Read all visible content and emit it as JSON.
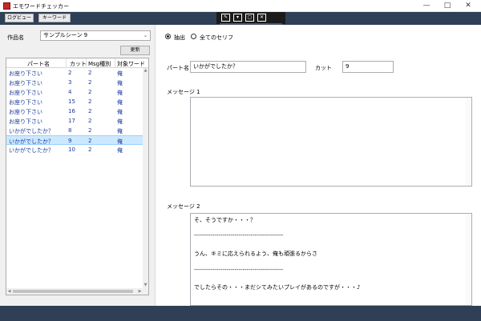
{
  "window": {
    "title": "エモワードチェッカー",
    "min_glyph": "—",
    "max_glyph": "□",
    "close_glyph": "✕"
  },
  "toolbar": {
    "copy_label": "ログビュー",
    "keyword_label": "キーワード"
  },
  "floating_toolbar": {
    "icons": [
      "edit-icon",
      "comment-icon",
      "frame-icon",
      "close-frame-icon"
    ],
    "glyphs": [
      "✎",
      "▾",
      "▢",
      "✕"
    ]
  },
  "left": {
    "work_label": "作品名",
    "work_value": "サンプルシーン 9",
    "refresh_label": "更新",
    "columns": [
      "パート名",
      "カット",
      "Msg種別",
      "対象ワード"
    ],
    "rows": [
      {
        "part": "お座り下さい",
        "cut": "2",
        "msg": "2",
        "word": "俺"
      },
      {
        "part": "お座り下さい",
        "cut": "3",
        "msg": "2",
        "word": "俺"
      },
      {
        "part": "お座り下さい",
        "cut": "4",
        "msg": "2",
        "word": "俺"
      },
      {
        "part": "お座り下さい",
        "cut": "15",
        "msg": "2",
        "word": "俺"
      },
      {
        "part": "お座り下さい",
        "cut": "16",
        "msg": "2",
        "word": "俺"
      },
      {
        "part": "お座り下さい",
        "cut": "17",
        "msg": "2",
        "word": "俺"
      },
      {
        "part": "いかがでしたか？",
        "cut": "8",
        "msg": "2",
        "word": "俺"
      },
      {
        "part": "いかがでしたか？",
        "cut": "9",
        "msg": "2",
        "word": "俺"
      },
      {
        "part": "いかがでしたか？",
        "cut": "10",
        "msg": "2",
        "word": "俺"
      }
    ],
    "selected_row": 7
  },
  "right": {
    "radio_extract": "抽出",
    "radio_all": "全てのセリフ",
    "part_label": "パート名",
    "part_value": "いかがでしたか？",
    "cut_label": "カット",
    "cut_value": "9",
    "msg1_label": "メッセージ 1",
    "msg2_label": "メッセージ 2",
    "msg2_lines": [
      "そ、そうですか・・・？",
      "--------------------------------------------",
      "うん、キミに応えられるよう、俺も頑張るからさ",
      "--------------------------------------------",
      "でしたらその・・・まだシてみたいプレイがあるのですが・・・♪"
    ]
  },
  "colors": {
    "toolbar_bg": "#2f3f55",
    "selected_row": "#cce8ff",
    "row_text": "#1a3a9a"
  }
}
